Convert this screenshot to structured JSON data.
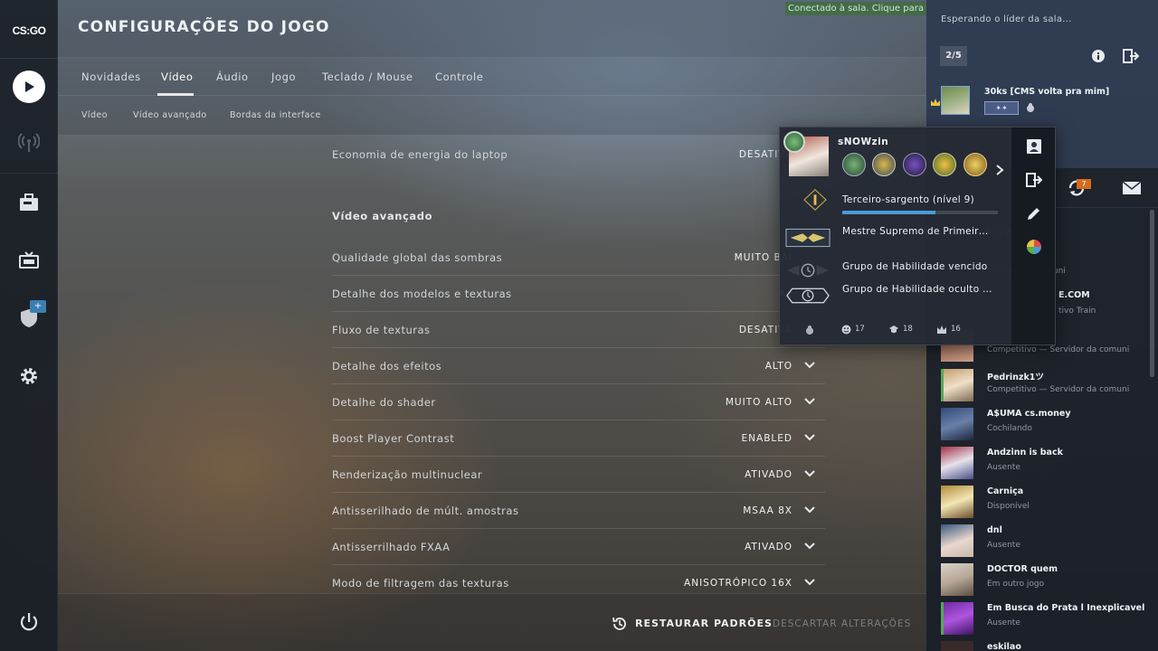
{
  "app": {
    "logo_text": "CS:GO"
  },
  "header": {
    "title": "CONFIGURAÇÕES DO JOGO",
    "connection_banner": "Conectado à sala. Clique para"
  },
  "tabs": [
    {
      "label": "Novidades"
    },
    {
      "label": "Vídeo",
      "active": true
    },
    {
      "label": "Áudio"
    },
    {
      "label": "Jogo"
    },
    {
      "label": "Teclado / Mouse"
    },
    {
      "label": "Controle"
    }
  ],
  "subtabs": [
    {
      "label": "Vídeo"
    },
    {
      "label": "Vídeo avançado"
    },
    {
      "label": "Bordas da interface"
    }
  ],
  "settings": {
    "top_row": {
      "label": "Economia de energia do laptop",
      "value": "DESATIVA"
    },
    "section_title": "Vídeo avançado",
    "rows": [
      {
        "label": "Qualidade global das sombras",
        "value": "MUITO BAI"
      },
      {
        "label": "Detalhe dos modelos e texturas",
        "value": "AL"
      },
      {
        "label": "Fluxo de texturas",
        "value": "DESATIVA"
      },
      {
        "label": "Detalhe dos efeitos",
        "value": "ALTO"
      },
      {
        "label": "Detalhe do shader",
        "value": "MUITO ALTO"
      },
      {
        "label": "Boost Player Contrast",
        "value": "ENABLED"
      },
      {
        "label": "Renderização multinuclear",
        "value": "ATIVADO"
      },
      {
        "label": "Antisserilhado de múlt. amostras",
        "value": "MSAA 8X"
      },
      {
        "label": "Antisserrilhado FXAA",
        "value": "ATIVADO"
      },
      {
        "label": "Modo de filtragem das texturas",
        "value": "ANISOTRÓPICO 16X"
      }
    ]
  },
  "footer": {
    "restore_label": "RESTAURAR PADRÕES",
    "discard_label": "DESCARTAR ALTERAÇÕES"
  },
  "lobby": {
    "waiting_text": "Esperando o líder da sala...",
    "count": "2/5",
    "member": {
      "name": "30ks [CMS volta pra mim]",
      "rank_badge": "✦✦"
    }
  },
  "notifications": {
    "count": "7"
  },
  "popup": {
    "name": "sNOWzin",
    "level_label": "Terceiro-sargento (nível 9)",
    "xp_fraction": 0.6,
    "rank_label": "Mestre Supremo de Primeir…",
    "group1_label": "Grupo de Habilidade vencido",
    "group2_label": "Grupo de Habilidade oculto …",
    "stats": {
      "friendly": "17",
      "teacher": "18",
      "leader": "16"
    }
  },
  "friends": [
    {
      "name": "",
      "status": "tivo Vertigo",
      "partial": true
    },
    {
      "name": "",
      "status": "Servidor da comuni",
      "partial": true
    },
    {
      "name": "E.COM",
      "status": "tivo Train",
      "partial": true
    },
    {
      "name": "",
      "status": "Competitivo — Servidor da comuni",
      "partial": true
    },
    {
      "name": "Pedrinzk1ツ",
      "status": "Competitivo — Servidor da comuni"
    },
    {
      "name": "A$UMA cs.money",
      "status": "Cochilando"
    },
    {
      "name": "Andzinn is back",
      "status": "Ausente"
    },
    {
      "name": "Carniça",
      "status": "Disponível"
    },
    {
      "name": "dnl",
      "status": "Ausente"
    },
    {
      "name": "DOCTOR quem",
      "status": "Em outro jogo"
    },
    {
      "name": "Em Busca do Prata l Inexplicavel",
      "status": "Ausente"
    },
    {
      "name": "eskilao",
      "status": ""
    }
  ],
  "colors": {
    "accent_blue": "#4a9ad8",
    "online_green": "#55a85a",
    "notif_orange": "#d66a1f"
  }
}
